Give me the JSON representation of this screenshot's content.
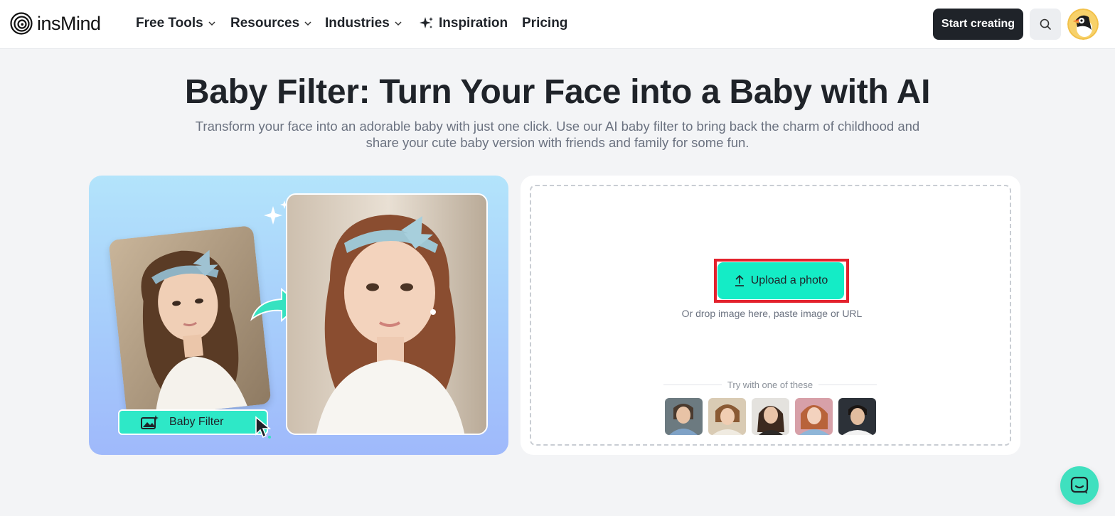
{
  "brand": {
    "name": "insMind"
  },
  "nav": {
    "free_tools": "Free Tools",
    "resources": "Resources",
    "industries": "Industries",
    "inspiration": "Inspiration",
    "pricing": "Pricing"
  },
  "header": {
    "start_creating": "Start creating"
  },
  "hero": {
    "title": "Baby Filter: Turn Your Face into a Baby with AI",
    "subtitle": "Transform your face into an adorable baby with just one click. Use our AI baby filter to bring back the charm of childhood and share your cute baby version with friends and family for some fun."
  },
  "banner": {
    "filter_label": "Baby Filter"
  },
  "upload": {
    "button_label": "Upload a photo",
    "drop_hint": "Or drop image here, paste image or URL",
    "try_label": "Try with one of these",
    "samples": [
      "sample-1",
      "sample-2",
      "sample-3",
      "sample-4",
      "sample-5"
    ]
  },
  "colors": {
    "accent": "#14ecc6",
    "dark_button": "#1f2329",
    "highlight": "#e3222d",
    "background": "#f3f4f6"
  }
}
